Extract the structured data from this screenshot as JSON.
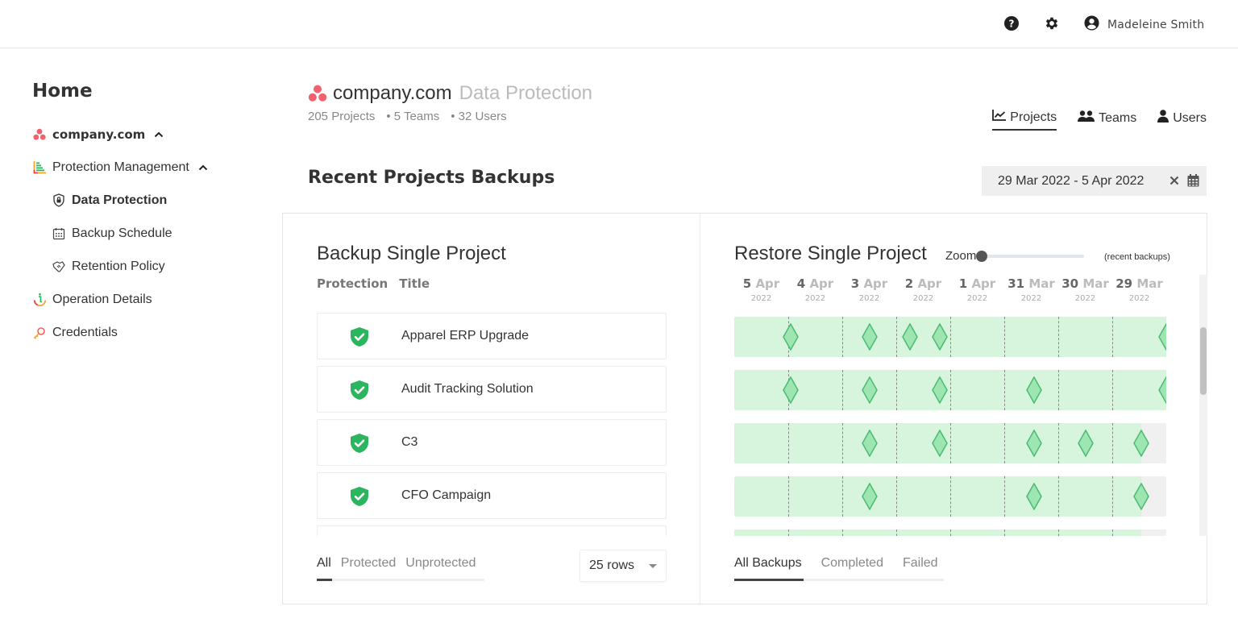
{
  "topbar": {
    "help_icon": "question-circle-icon",
    "settings_icon": "gear-icon",
    "user_icon": "user-circle-icon",
    "user_name": "Madeleine Smith"
  },
  "sidebar": {
    "home_title": "Home",
    "org": {
      "label": "company.com",
      "icon": "asana-logo-icon",
      "expanded": true
    },
    "items": [
      {
        "label": "Protection Management",
        "icon": "bars-chart-icon",
        "expanded": true,
        "level": 0
      },
      {
        "label": "Data Protection",
        "icon": "shield-lock-icon",
        "level": 1,
        "active": true
      },
      {
        "label": "Backup Schedule",
        "icon": "calendar-icon",
        "level": 1
      },
      {
        "label": "Retention Policy",
        "icon": "handshake-icon",
        "level": 1
      },
      {
        "label": "Operation Details",
        "icon": "info-icon",
        "level": 0
      },
      {
        "label": "Credentials",
        "icon": "key-icon",
        "level": 0
      }
    ]
  },
  "header": {
    "org_name": "company.com",
    "page_name": "Data Protection",
    "stats": [
      "205 Projects",
      "• 5 Teams",
      "• 32 Users"
    ],
    "view_tabs": [
      {
        "label": "Projects",
        "icon": "line-chart-icon",
        "active": true
      },
      {
        "label": "Teams",
        "icon": "users-icon",
        "active": false
      },
      {
        "label": "Users",
        "icon": "user-icon",
        "active": false
      }
    ],
    "section_title": "Recent Projects Backups",
    "date_range": "29 Mar 2022 - 5 Apr 2022"
  },
  "backup_panel": {
    "title": "Backup Single Project",
    "columns": [
      "Protection",
      "Title"
    ],
    "rows": [
      {
        "title": "Apparel ERP Upgrade",
        "status": "protected"
      },
      {
        "title": "Audit Tracking Solution",
        "status": "protected"
      },
      {
        "title": "C3",
        "status": "protected"
      },
      {
        "title": "CFO Campaign",
        "status": "protected"
      },
      {
        "title": "",
        "status": ""
      }
    ],
    "filter_tabs": [
      {
        "label": "All",
        "active": true
      },
      {
        "label": "Protected",
        "active": false
      },
      {
        "label": "Unprotected",
        "active": false
      }
    ],
    "rows_per_page": "25 rows"
  },
  "restore_panel": {
    "title": "Restore Single Project",
    "zoom_label": "Zoom",
    "zoom_value": 0,
    "zoom_hint": "(recent backups)",
    "dates": [
      {
        "day": "5",
        "month": "Apr",
        "year": "2022"
      },
      {
        "day": "4",
        "month": "Apr",
        "year": "2022"
      },
      {
        "day": "3",
        "month": "Apr",
        "year": "2022"
      },
      {
        "day": "2",
        "month": "Apr",
        "year": "2022"
      },
      {
        "day": "1",
        "month": "Apr",
        "year": "2022"
      },
      {
        "day": "31",
        "month": "Mar",
        "year": "2022"
      },
      {
        "day": "30",
        "month": "Mar",
        "year": "2022"
      },
      {
        "day": "29",
        "month": "Mar",
        "year": "2022"
      }
    ],
    "timeline_rows": [
      {
        "coverage_days": 8,
        "backups_days_ago": [
          1.05,
          2.5,
          3.25,
          3.8,
          8.0
        ]
      },
      {
        "coverage_days": 8,
        "backups_days_ago": [
          1.05,
          2.5,
          3.8,
          5.55,
          8.0
        ]
      },
      {
        "coverage_days": 7.54,
        "backups_days_ago": [
          2.5,
          3.8,
          5.55,
          6.5,
          7.54
        ]
      },
      {
        "coverage_days": 7.54,
        "backups_days_ago": [
          2.5,
          5.55,
          7.54
        ]
      },
      {
        "coverage_days": 7.54,
        "backups_days_ago": []
      }
    ],
    "status_tabs": [
      {
        "label": "All Backups",
        "active": true
      },
      {
        "label": "Completed",
        "active": false
      },
      {
        "label": "Failed",
        "active": false
      }
    ],
    "colors": {
      "coverage": "#d7f5dd",
      "diamond_fill": "#9de6b1",
      "diamond_stroke": "#4cbb72",
      "protected_shield": "#2bb55e"
    }
  }
}
